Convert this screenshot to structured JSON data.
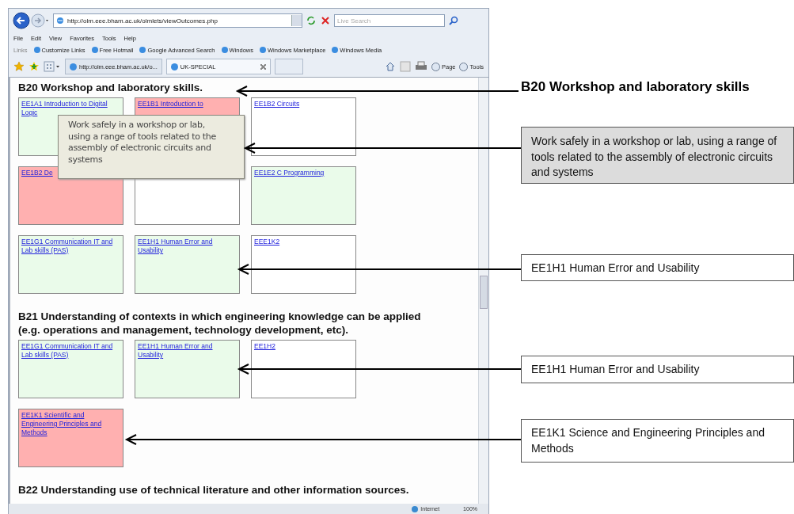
{
  "browser": {
    "address": "http://olm.eee.bham.ac.uk/olmlets/viewOutcomes.php",
    "search_placeholder": "Live Search",
    "menu": [
      "File",
      "Edit",
      "View",
      "Favorites",
      "Tools",
      "Help"
    ],
    "links_label": "Links",
    "links": [
      "Customize Links",
      "Free Hotmail",
      "Google Advanced Search",
      "Windows",
      "Windows Marketplace",
      "Windows Media"
    ],
    "tabs": [
      {
        "label": "http://olm.eee.bham.ac.uk/o...",
        "selected": false
      },
      {
        "label": "UK-SPECIAL",
        "selected": true
      }
    ],
    "commands": [
      "Page",
      "Tools"
    ],
    "status_bar": {
      "zone": "Internet",
      "zoom": "100%"
    }
  },
  "page": {
    "sections": [
      {
        "heading": "B20 Workshop and laboratory skills.",
        "cards": [
          {
            "title": "EE1A1 Introduction to Digital Logic",
            "color": "#eafbea"
          },
          {
            "title": "EE1B1 Introduction to",
            "color": "#ffb0b0"
          },
          {
            "title": "EE1B2 Circuits",
            "color": "#ffffff"
          },
          {
            "title": "EE1B2 De",
            "color": "#ffb0b0"
          },
          {
            "color": "#ffffff"
          },
          {
            "title": "EE1E2 C Programming",
            "color": "#eafbea"
          },
          {
            "title": "EE1G1 Communication IT and Lab skills (PAS)",
            "color": "#eafbea"
          },
          {
            "title": "EE1H1 Human Error and Usability",
            "color": "#eafbea"
          },
          {
            "title": "EEE1K2",
            "color": "#ffffff"
          }
        ]
      },
      {
        "heading": "B21 Understanding of contexts in which engineering knowledge can be applied (e.g. operations and management, technology development, etc).",
        "cards": [
          {
            "title": "EE1G1 Communication IT and Lab skills (PAS)",
            "color": "#eafbea"
          },
          {
            "title": "EE1H1 Human Error and Usability",
            "color": "#eafbea"
          },
          {
            "title": "EE1H2",
            "color": "#ffffff"
          },
          {
            "title": "EE1K1 Scientific and Engineering Principles and Methods",
            "color": "#ffb0b0"
          }
        ]
      },
      {
        "heading": "B22 Understanding use of technical literature and other information sources."
      }
    ],
    "tooltip": "Work safely in a workshop or lab, using a range of tools related to the assembly of electronic circuits and systems"
  },
  "annotations": {
    "heading": "B20 Workshop and laboratory skills",
    "callouts": [
      {
        "text": "Work safely in a workshop or lab, using a range of tools related to the assembly of electronic circuits and systems",
        "shaded": true
      },
      {
        "text": "EE1H1 Human Error and Usability",
        "shaded": false
      },
      {
        "text": "EE1H1 Human Error and Usability",
        "shaded": false
      },
      {
        "text": "EE1K1 Science and Engineering Principles and Methods",
        "shaded": false
      }
    ]
  }
}
